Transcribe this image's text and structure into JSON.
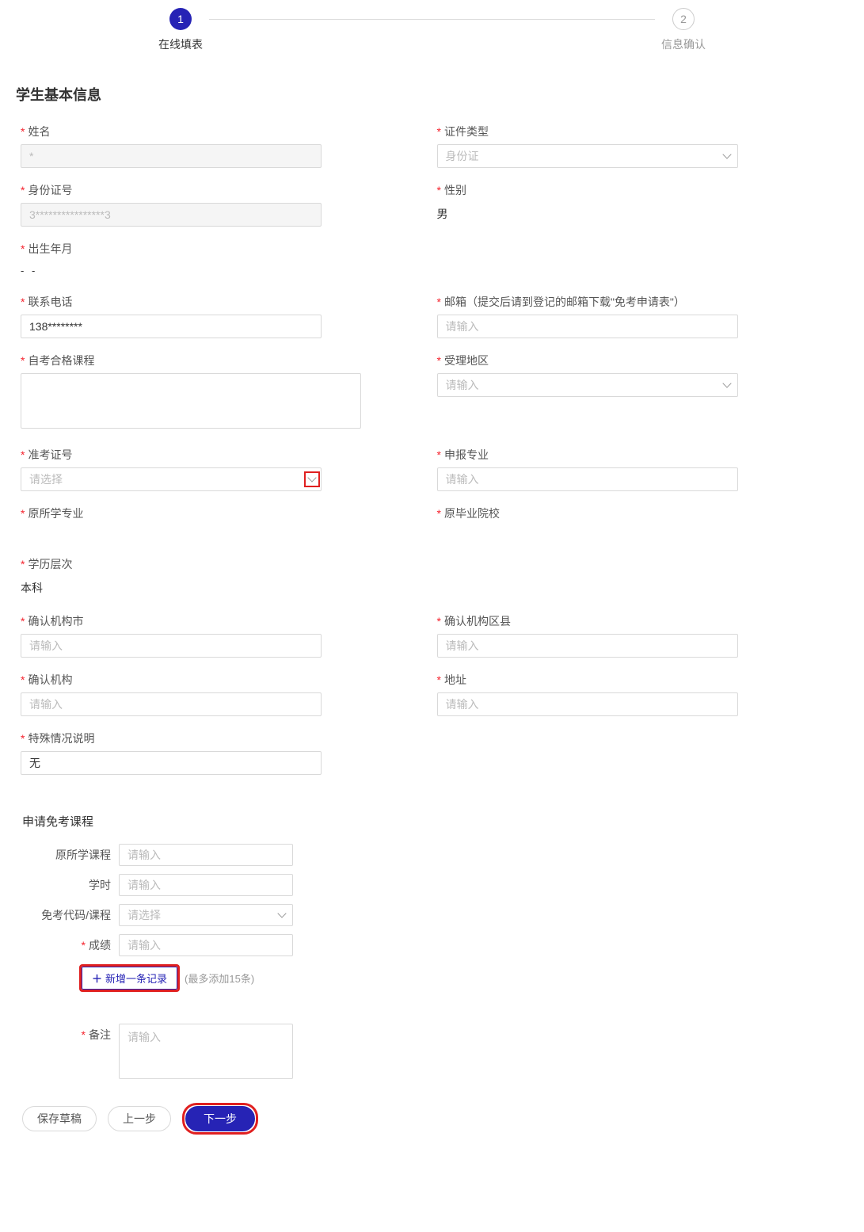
{
  "steps": {
    "step1_num": "1",
    "step1_label": "在线填表",
    "step2_num": "2",
    "step2_label": "信息确认"
  },
  "section_title": "学生基本信息",
  "fields": {
    "name_label": "姓名",
    "name_value": "*",
    "cert_type_label": "证件类型",
    "cert_type_value": "身份证",
    "idcard_label": "身份证号",
    "idcard_value": "3****************3",
    "gender_label": "性别",
    "gender_value": "男",
    "dob_label": "出生年月",
    "dob_value": "-    -",
    "phone_label": "联系电话",
    "phone_value": "138********",
    "email_label": "邮箱（提交后请到登记的邮箱下载\"免考申请表\"）",
    "email_placeholder": "请输入",
    "pass_course_label": "自考合格课程",
    "region_label": "受理地区",
    "region_placeholder": "请输入",
    "ticket_label": "准考证号",
    "ticket_placeholder": "请选择",
    "apply_major_label": "申报专业",
    "apply_major_placeholder": "请输入",
    "orig_major_label": "原所学专业",
    "orig_school_label": "原毕业院校",
    "edu_level_label": "学历层次",
    "edu_level_value": "本科",
    "confirm_city_label": "确认机构市",
    "confirm_city_placeholder": "请输入",
    "confirm_district_label": "确认机构区县",
    "confirm_district_placeholder": "请输入",
    "confirm_org_label": "确认机构",
    "confirm_org_placeholder": "请输入",
    "address_label": "地址",
    "address_placeholder": "请输入",
    "special_label": "特殊情况说明",
    "special_value": "无"
  },
  "course_section": {
    "title": "申请免考课程",
    "orig_course_label": "原所学课程",
    "orig_course_placeholder": "请输入",
    "hours_label": "学时",
    "hours_placeholder": "请输入",
    "exempt_code_label": "免考代码/课程",
    "exempt_code_placeholder": "请选择",
    "score_label": "成绩",
    "score_placeholder": "请输入",
    "add_btn_label": "新增一条记录",
    "add_limit_text": "(最多添加15条)"
  },
  "remark": {
    "label": "备注",
    "placeholder": "请输入"
  },
  "buttons": {
    "save_draft": "保存草稿",
    "prev_step": "上一步",
    "next_step": "下一步"
  }
}
